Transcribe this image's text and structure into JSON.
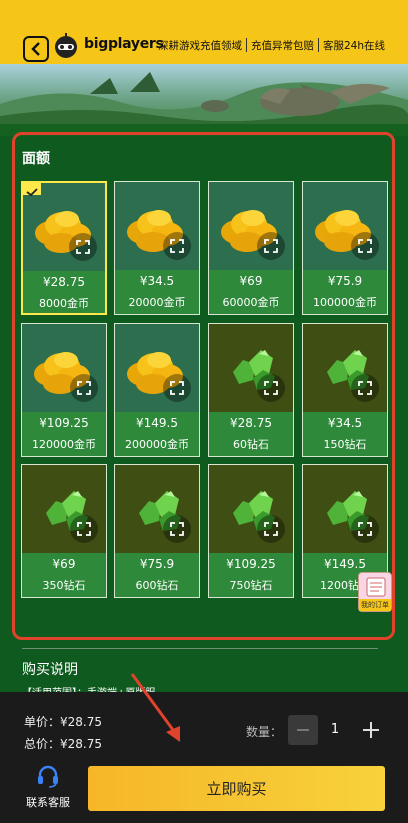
{
  "header": {
    "brand": "bigplayers",
    "slogans": [
      "深耕游戏充值领域",
      "充值异常包赔",
      "客服24h在线"
    ]
  },
  "panel": {
    "title": "面额",
    "items": [
      {
        "price": "¥28.75",
        "qty": "8000金币",
        "kind": "gold",
        "selected": true
      },
      {
        "price": "¥34.5",
        "qty": "20000金币",
        "kind": "gold"
      },
      {
        "price": "¥69",
        "qty": "60000金币",
        "kind": "gold"
      },
      {
        "price": "¥75.9",
        "qty": "100000金币",
        "kind": "gold"
      },
      {
        "price": "¥109.25",
        "qty": "120000金币",
        "kind": "gold"
      },
      {
        "price": "¥149.5",
        "qty": "200000金币",
        "kind": "gold"
      },
      {
        "price": "¥28.75",
        "qty": "60钻石",
        "kind": "gem"
      },
      {
        "price": "¥34.5",
        "qty": "150钻石",
        "kind": "gem"
      },
      {
        "price": "¥69",
        "qty": "350钻石",
        "kind": "gem"
      },
      {
        "price": "¥75.9",
        "qty": "600钻石",
        "kind": "gem"
      },
      {
        "price": "¥109.25",
        "qty": "750钻石",
        "kind": "gem"
      },
      {
        "price": "¥149.5",
        "qty": "1200钻石",
        "kind": "gem"
      }
    ]
  },
  "description": {
    "title": "购买说明",
    "text": "【适用范围】：手游端+原版服"
  },
  "order_badge": "我的订单",
  "purchase": {
    "unit_price": "单价：¥28.75",
    "total_price": "总价：¥28.75",
    "quantity_label": "数量：",
    "quantity_value": "1",
    "service_label": "联系客服",
    "buy_label": "立即购买"
  },
  "colors": {
    "accent": "#f5c518",
    "panel_border": "#e0432b",
    "selected_border": "#ffe94a",
    "background": "#0f5a1f"
  }
}
